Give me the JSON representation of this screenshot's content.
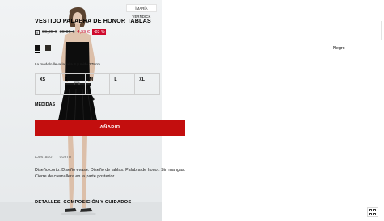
{
  "image": {
    "tag_label": "|MARÍA VERNDICK",
    "description_icon": "model-photo"
  },
  "product": {
    "title": "VESTIDO PALABRA DE HONOR TABLAS",
    "price_info_icon": "i",
    "old_price_1": "99,95 €",
    "old_price_2": "39,95 €",
    "new_price": "4,99 €",
    "discount": "-83 %",
    "colors": {
      "selected_name": "Negro",
      "swatches": [
        "#111111",
        "#2d2a25"
      ]
    },
    "model_note": "La modelo lleva la talla S y mide 178cm.",
    "sizes": [
      "XS",
      "S",
      "M",
      "L",
      "XL"
    ],
    "measures_label": "MEDIDAS",
    "add_button_label": "AÑADIR",
    "meta": [
      "AJUSTADO",
      "CORTO"
    ],
    "description": "Diseño corto. Diseño evasé. Diseño de tablas. Palabra de honor. Sin mangas. Cierre de cremallera en la parte posterior",
    "details_heading": "DETALLES, COMPOSICIÓN Y CUIDADOS"
  },
  "colors": {
    "accent_red": "#c30e0e",
    "price_red": "#cf0a2c"
  }
}
